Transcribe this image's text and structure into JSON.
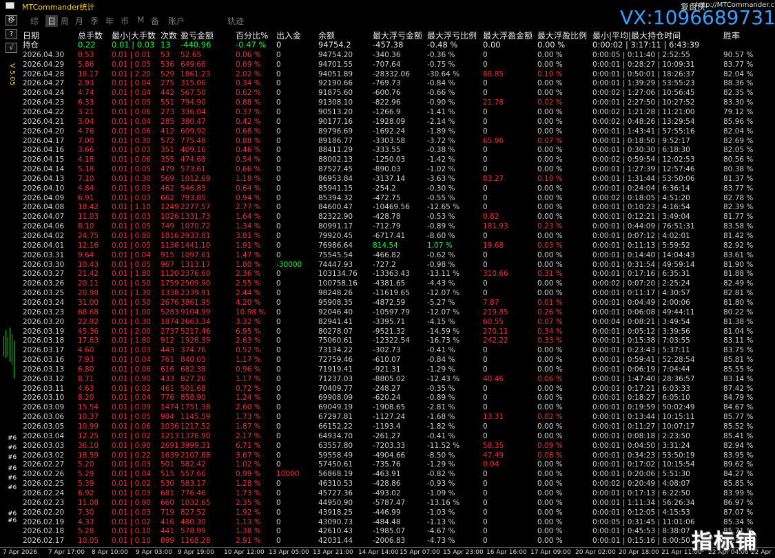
{
  "app_title": "MTCommander统计",
  "replay_label": "复盘侠",
  "website": "http://MTCommander.com",
  "wechat": "VX:1096689731",
  "version": "V 5.05",
  "left_buttons": [
    "移",
    "?",
    "√"
  ],
  "tabs": [
    "综",
    "日",
    "周",
    "月",
    "季",
    "年",
    "币",
    "M",
    "备",
    "账户",
    "轨迹"
  ],
  "active_tab": "日",
  "columns": [
    "日期",
    "总手数",
    "最小|大手数",
    "次数",
    "盈亏金额",
    "百分比%",
    "出入金",
    "余额",
    "最大浮亏金额",
    "最大浮亏比例",
    "最大浮盈金额",
    "最大浮盈比例",
    "最小|平均|最大持仓时间",
    "胜率"
  ],
  "holding": {
    "label": "持仓",
    "lots": "0.22",
    "minmax": "0.01 | 0.03",
    "count": "13",
    "pnl": "-440.96",
    "pct": "-0.47 %",
    "io": "0",
    "balance": "94754.2",
    "float_loss": "-457.38",
    "float_loss_pct": "-0.48 %",
    "float_profit": "0.00",
    "float_profit_pct": "0.00 %",
    "time": "0:00:02 | 3:17:11 | 6:43:39",
    "win": ""
  },
  "rows": [
    [
      "2026.04.30",
      "0.53",
      "0.01 | 0.01",
      "53",
      "52.65",
      "0.06 %",
      "0",
      "94754.20",
      "-340.36",
      "-0.36 %",
      "0",
      "0.00 %",
      "0:00:05 | 0:11:40 | 2:52:55",
      "90.57 %"
    ],
    [
      "2026.04.29",
      "5.86",
      "0.01 | 0.05",
      "536",
      "649.66",
      "0.69 %",
      "0",
      "94701.55",
      "-707.64",
      "-0.75 %",
      "0",
      "0.00 %",
      "0:00:01 | 0:28:27 | 10:09:31",
      "83.77 %"
    ],
    [
      "2026.04.28",
      "18.17",
      "0.01 | 2.20",
      "529",
      "1861.23",
      "2.02 %",
      "0",
      "94051.89",
      "-28332.06",
      "-30.64 %",
      "88.85",
      "0.10 %",
      "0:00:01 | 0:50:01 | 18:26:37",
      "82.04 %"
    ],
    [
      "2026.04.27",
      "2.93",
      "0.01 | 0.04",
      "275",
      "315.06",
      "0.34 %",
      "0",
      "92190.66",
      "-769.73",
      "-0.84 %",
      "0",
      "0.00 %",
      "0:00:01 | 1:39:29 | 53:55:23",
      "88.36 %"
    ],
    [
      "2026.04.24",
      "4.74",
      "0.01 | 0.04",
      "442",
      "567.50",
      "0.62 %",
      "0",
      "91875.60",
      "-600.76",
      "-0.66 %",
      "0",
      "0.00 %",
      "0:00:02 | 1:27:06 | 10:56:45",
      "82.35 %"
    ],
    [
      "2026.04.23",
      "6.33",
      "0.01 | 0.05",
      "551",
      "794.90",
      "0.88 %",
      "0",
      "91308.10",
      "-822.96",
      "-0.90 %",
      "21.78",
      "0.02 %",
      "0:00:01 | 2:27:50 | 10:27:52",
      "83.30 %"
    ],
    [
      "2026.04.22",
      "3.21",
      "0.01 | 0.06",
      "273",
      "336.04",
      "0.37 %",
      "0",
      "90513.20",
      "-1266.9",
      "-1.41 %",
      "0",
      "0.00 %",
      "0:00:02 | 1:21:28 | 11:21:00",
      "79.12 %"
    ],
    [
      "2026.04.21",
      "3.04",
      "0.01 | 0.04",
      "285",
      "380.47",
      "0.42 %",
      "0",
      "90177.16",
      "-1928.09",
      "-2.14 %",
      "0",
      "0.00 %",
      "0:00:02 | 0:48:26 | 13:29:54",
      "85.96 %"
    ],
    [
      "2026.04.20",
      "4.76",
      "0.01 | 0.06",
      "412",
      "609.92",
      "0.68 %",
      "0",
      "89796.69",
      "-1692.24",
      "-1.89 %",
      "0",
      "0.00 %",
      "0:00:01 | 1:43:41 | 57:55:16",
      "82.04 %"
    ],
    [
      "2026.04.17",
      "7.00",
      "0.01 | 0.30",
      "572",
      "775.48",
      "0.88 %",
      "0",
      "89186.77",
      "-3303.58",
      "-3.72 %",
      "65.96",
      "0.07 %",
      "0:00:01 | 0:18:50 | 9:52:17",
      "82.69 %"
    ],
    [
      "2026.04.16",
      "3.66",
      "0.01 | 0.03",
      "351",
      "409.16",
      "0.46 %",
      "0",
      "88411.29",
      "-333.55",
      "-0.38 %",
      "0",
      "0.00 %",
      "0:00:01 | 0:30:30 | 6:18:30",
      "82.05 %"
    ],
    [
      "2026.04.15",
      "4.18",
      "0.01 | 0.06",
      "355",
      "474.68",
      "0.54 %",
      "0",
      "88002.13",
      "-1250.03",
      "-1.42 %",
      "0",
      "0.00 %",
      "0:00:02 | 0:59:54 | 12:02:53",
      "80.56 %"
    ],
    [
      "2026.04.14",
      "5.18",
      "0.01 | 0.05",
      "479",
      "573.61",
      "0.66 %",
      "0",
      "87527.45",
      "-890.03",
      "-1.02 %",
      "0",
      "0.00 %",
      "0:00:01 | 1:27:39 | 12:57:46",
      "80.38 %"
    ],
    [
      "2026.04.13",
      "7.10",
      "0.01 | 0.30",
      "569",
      "1012.69",
      "1.18 %",
      "0",
      "86953.84",
      "-3137.14",
      "-3.63 %",
      "83.27",
      "0.10 %",
      "0:00:01 | 1:31:44 | 53:50:06",
      "81.37 %"
    ],
    [
      "2026.04.10",
      "4.84",
      "0.01 | 0.03",
      "462",
      "546.83",
      "0.64 %",
      "0",
      "85941.15",
      "-254.2",
      "-0.30 %",
      "0",
      "0.00 %",
      "0:00:01 | 0:24:04 | 6:36:14",
      "83.77 %"
    ],
    [
      "2026.04.09",
      "6.91",
      "0.01 | 0.03",
      "662",
      "793.85",
      "0.94 %",
      "0",
      "85394.32",
      "-472.75",
      "-0.55 %",
      "0",
      "0.00 %",
      "0:00:02 | 0:18:05 | 4:51:20",
      "82.78 %"
    ],
    [
      "2026.04.08",
      "18.42",
      "0.01 | 1.10",
      "1249",
      "2277.57",
      "2.77 %",
      "0",
      "84600.47",
      "-10469.56",
      "-12.65 %",
      "0",
      "0.00 %",
      "0:00:01 | 0:10:23 | 4:16:54",
      "82.39 %"
    ],
    [
      "2026.04.07",
      "11.03",
      "0.01 | 0.03",
      "1026",
      "1331.73",
      "1.64 %",
      "0",
      "82322.90",
      "-428.78",
      "-0.53 %",
      "0.82",
      "0.00 %",
      "0:00:01 | 0:12:21 | 3:49:04",
      "81.77 %"
    ],
    [
      "2026.04.06",
      "8.10",
      "0.01 | 0.05",
      "749",
      "1070.72",
      "1.34 %",
      "0",
      "80991.17",
      "-712.79",
      "-0.89 %",
      "181.93",
      "0.23 %",
      "0:00:01 | 0:44:09 | 76:51:31",
      "83.58 %"
    ],
    [
      "2026.04.02",
      "24.75",
      "0.01 | 0.80",
      "1816",
      "2933.81",
      "3.81 %",
      "0",
      "79920.45",
      "-6717.41",
      "-8.60 %",
      "0",
      "0.00 %",
      "0:00:01 | 0:07:12 | 4:02:01",
      "81.42 %"
    ],
    [
      "2026.04.01",
      "12.16",
      "0.01 | 0.05",
      "1136",
      "1441.10",
      "1.91 %",
      "0",
      "76986.64",
      "814.54",
      "1.07 %",
      "19.68",
      "0.03 %",
      "0:00:01 | 0:11:13 | 5:59:52",
      "82.92 %"
    ],
    [
      "2026.03.31",
      "9.64",
      "0.01 | 0.04",
      "915",
      "1097.61",
      "1.47 %",
      "0",
      "75545.54",
      "-466.82",
      "-0.62 %",
      "0",
      "0.00 %",
      "0:00:01 | 0:14:40 | 14:04:43",
      "83.61 %"
    ],
    [
      "2026.03.30",
      "10.43",
      "0.01 | 0.05",
      "967",
      "1313.17",
      "1.80 %",
      "-30000",
      "74447.93",
      "-727.2",
      "-0.98 %",
      "0",
      "0.00 %",
      "0:00:01 | 0:31:54 | 49:59:14",
      "81.90 %"
    ],
    [
      "2026.03.27",
      "21.42",
      "0.01 | 1.80",
      "1120",
      "2376.60",
      "2.36 %",
      "0",
      "103134.76",
      "-13363.43",
      "-13.11 %",
      "310.66",
      "0.31 %",
      "0:00:01 | 0:17:16 | 6:35:31",
      "81.88 %"
    ],
    [
      "2026.03.26",
      "20.11",
      "0.01 | 0.50",
      "1759",
      "2509.90",
      "2.55 %",
      "0",
      "100758.16",
      "-4381.65",
      "-4.43 %",
      "0",
      "0.00 %",
      "0:00:02 | 0:07:20 | 2:25:24",
      "82.49 %"
    ],
    [
      "2026.03.25",
      "20.98",
      "0.01 | 1.30",
      "1338",
      "2339.91",
      "2.44 %",
      "0",
      "98248.26",
      "-11619.65",
      "-12.07 %",
      "0",
      "0.00 %",
      "0:00:01 | 0:11:17 | 4:30:57",
      "82.81 %"
    ],
    [
      "2026.03.24",
      "31.00",
      "0.01 | 0.50",
      "2676",
      "3861.95",
      "4.20 %",
      "0",
      "95908.35",
      "-4872.59",
      "-5.27 %",
      "7.87",
      "0.01 %",
      "0:00:01 | 0:04:49 | 2:00:06",
      "81.80 %"
    ],
    [
      "2026.03.23",
      "68.68",
      "0.01 | 1.00",
      "5283",
      "9104.99",
      "10.98 %",
      "0",
      "92046.40",
      "-10597.79",
      "-12.07 %",
      "219.85",
      "0.26 %",
      "0:00:01 | 0:06:08 | 49:44:11",
      "80.22 %"
    ],
    [
      "2026.03.20",
      "22.92",
      "0.01 | 0.30",
      "1874",
      "2663.34",
      "3.32 %",
      "0",
      "82941.41",
      "-3395.71",
      "-4.15 %",
      "60.55",
      "0.07 %",
      "0:00:04 | 0:08:21 | 3:49:54",
      "81.38 %"
    ],
    [
      "2026.03.19",
      "45.36",
      "0.01 | 2.00",
      "2737",
      "5217.46",
      "6.95 %",
      "0",
      "80278.07",
      "-9521.32",
      "-14.59 %",
      "270.11",
      "0.34 %",
      "0:00:01 | 0:05:12 | 3:39:56",
      "81.04 %"
    ],
    [
      "2026.03.18",
      "17.83",
      "0.01 | 1.80",
      "912",
      "1926.39",
      "2.63 %",
      "0",
      "75060.61",
      "-12322.54",
      "-16.73 %",
      "242.22",
      "0.33 %",
      "0:00:01 | 0:15:38 | 7:03:55",
      "83.11 %"
    ],
    [
      "2026.03.17",
      "4.60",
      "0.01 | 0.03",
      "443",
      "374.76",
      "0.52 %",
      "0",
      "73134.22",
      "-302.73",
      "-0.41 %",
      "0",
      "0.00 %",
      "0:00:01 | 0:23:43 | 5:37:11",
      "83.75 %"
    ],
    [
      "2026.03.16",
      "7.93",
      "0.01 | 0.04",
      "761",
      "840.05",
      "1.17 %",
      "0",
      "72759.46",
      "-610.07",
      "-0.84 %",
      "0",
      "0.00 %",
      "0:00:01 | 0:59:41 | 52:28:54",
      "85.81 %"
    ],
    [
      "2026.03.13",
      "6.80",
      "0.01 | 0.06",
      "616",
      "682.38",
      "0.96 %",
      "0",
      "71919.41",
      "-921.31",
      "-1.29 %",
      "0",
      "0.00 %",
      "0:00:01 | 0:06:19 | 7:04:44",
      "85.55 %"
    ],
    [
      "2026.03.12",
      "8.71",
      "0.01 | 0.90",
      "433",
      "827.26",
      "1.17 %",
      "0",
      "71237.03",
      "-8805.02",
      "-12.43 %",
      "40.46",
      "0.06 %",
      "0:00:01 | 1:47:40 | 28:36:57",
      "83.14 %"
    ],
    [
      "2026.03.11",
      "4.63",
      "0.01 | 0.02",
      "461",
      "501.68",
      "0.72 %",
      "0",
      "70409.77",
      "-248.27",
      "-0.35 %",
      "0",
      "0.00 %",
      "0:00:01 | 0:17:21 | 6:03:33",
      "87.42 %"
    ],
    [
      "2026.03.10",
      "8.20",
      "0.01 | 0.04",
      "776",
      "858.90",
      "1.24 %",
      "0",
      "69908.09",
      "-620.24",
      "-0.89 %",
      "0",
      "0.00 %",
      "0:00:01 | 0:18:27 | 6:05:10",
      "84.79 %"
    ],
    [
      "2026.03.09",
      "15.54",
      "0.01 | 0.09",
      "1474",
      "1751.38",
      "2.60 %",
      "0",
      "69049.19",
      "-1908.65",
      "-2.81 %",
      "0",
      "0.00 %",
      "0:00:01 | 0:19:59 | 50:02:49",
      "84.67 %"
    ],
    [
      "2026.03.06",
      "10.37",
      "0.01 | 0.05",
      "984",
      "1145.59",
      "1.73 %",
      "0",
      "67297.81",
      "-1127.24",
      "-1.68 %",
      "13.31",
      "0.02 %",
      "0:00:01 | 0:13:44 | 10:15:11",
      "85.77 %"
    ],
    [
      "2026.03.05",
      "10.99",
      "0.01 | 0.06",
      "1036",
      "1217.52",
      "1.87 %",
      "0",
      "66152.22",
      "-1193.4",
      "-1.82 %",
      "0",
      "0.00 %",
      "0:00:01 | 0:11:27 | 10:07:17",
      "85.52 %"
    ],
    [
      "2026.03.04",
      "12.25",
      "0.01 | 0.02",
      "1213",
      "1376.90",
      "2.17 %",
      "0",
      "64934.70",
      "-261.27",
      "-0.41 %",
      "0",
      "0.00 %",
      "0:00:01 | 0:08:18 | 2:23:50",
      "85.41 %"
    ],
    [
      "2026.03.03",
      "36.10",
      "0.01 | 0.90",
      "2691",
      "3999.31",
      "6.71 %",
      "0",
      "63557.80",
      "-7203.33",
      "-11.52 %",
      "58.35",
      "0.09 %",
      "0:00:01 | 0:04:50 | 3:31:24",
      "82.94 %"
    ],
    [
      "2026.03.02",
      "18.59",
      "0.01 | 0.22",
      "1639",
      "2107.88",
      "3.67 %",
      "0",
      "59558.49",
      "-4904.66",
      "-8.50 %",
      "47.49",
      "0.08 %",
      "0:00:01 | 0:34:23 | 53:50:19",
      "83.95 %"
    ],
    [
      "2026.02.27",
      "5.20",
      "0.01 | 0.03",
      "501",
      "582.42",
      "1.02 %",
      "0",
      "57450.61",
      "-735.76",
      "-1.29 %",
      "0.04",
      "0.00 %",
      "0:00:01 | 0:17:02 | 10:15:54",
      "89.62 %"
    ],
    [
      "2026.02.26",
      "5.29",
      "0.01 | 0.04",
      "515",
      "557.66",
      "0.99 %",
      "10000",
      "56868.19",
      "-463.91",
      "-0.82 %",
      "0",
      "0.00 %",
      "0:00:01 | 0:20:06 | 5:51:30",
      "84.27 %"
    ],
    [
      "2026.02.25",
      "5.39",
      "0.01 | 0.02",
      "530",
      "583.17",
      "1.28 %",
      "0",
      "46310.53",
      "-428.86",
      "-0.93 %",
      "0",
      "0.00 %",
      "0:00:02 | 0:20:49 | 4:08:07",
      "85.85 %"
    ],
    [
      "2026.02.24",
      "6.92",
      "0.01 | 0.03",
      "681",
      "776.46",
      "1.73 %",
      "0",
      "45727.36",
      "-493.02",
      "-1.09 %",
      "0",
      "0.00 %",
      "0:00:01 | 0:17:13 | 6:22:50",
      "83.99 %"
    ],
    [
      "2026.02.23",
      "11.08",
      "0.01 | 0.90",
      "660",
      "1032.65",
      "2.35 %",
      "0",
      "44950.90",
      "-5787.47",
      "-13.16 %",
      "0",
      "0.00 %",
      "0:00:01 | 1:11:34 | 56:26:34",
      "86.97 %"
    ],
    [
      "2026.02.20",
      "7.30",
      "0.01 | 0.03",
      "719",
      "827.52",
      "1.92 %",
      "0",
      "43918.25",
      "-446.99",
      "-1.03 %",
      "0",
      "0.00 %",
      "0:00:01 | 0:12:05 | 4:15:53",
      "87.07 %"
    ],
    [
      "2026.02.19",
      "4.33",
      "0.01 | 0.02",
      "416",
      "480.30",
      "1.13 %",
      "0",
      "43090.73",
      "-484.48",
      "-1.13 %",
      "0",
      "0.00 %",
      "0:00:05 | 0:31:45 | 11:01:06",
      "85.34 %"
    ],
    [
      "2026.02.18",
      "5.28",
      "0.01 | 0.10",
      "441",
      "578.99",
      "1.38 %",
      "0",
      "42610.43",
      "-1985.07",
      "-4.67 %",
      "0",
      "0.00 %",
      "0:00:01 | 0:45:53 | 8:38:07",
      "85.71 %"
    ],
    [
      "2026.02.17",
      "10.05",
      "0.01 | 0.10",
      "899",
      "1168.28",
      "2.91 %",
      "0",
      "42031.44",
      "-2006.83",
      "-4.73 %",
      "0",
      "0.00 %",
      "0:00:01 | 0:15:16 | 8:00:50",
      "85.32 %"
    ]
  ],
  "time_axis": [
    "7 Apr 2026",
    "7 Apr 17:00",
    "8 Apr 10:00",
    "9 Apr 03:00",
    "9 Apr 19:00",
    "10 Apr 12:00",
    "13 Apr 05:00",
    "13 Apr 21:00",
    "14 Apr 14:00",
    "15 Apr 07:00",
    "15 Apr 23:00",
    "16 Apr 16:00",
    "17 Apr 09:00",
    "20 Apr 02:00",
    "20 Apr 18:00",
    "21 Apr 11:00",
    "22 Apr 04:00",
    "22 Apr"
  ],
  "side_tags": [
    "#6",
    "#6",
    "#6",
    "#6",
    "#6",
    "#6",
    "#6",
    "#6"
  ],
  "watermark": "指标铺",
  "colors": {
    "red": "#ff2a2a",
    "green": "#00ff33",
    "blue": "#3aa0ff",
    "yellow": "#ffd200"
  }
}
